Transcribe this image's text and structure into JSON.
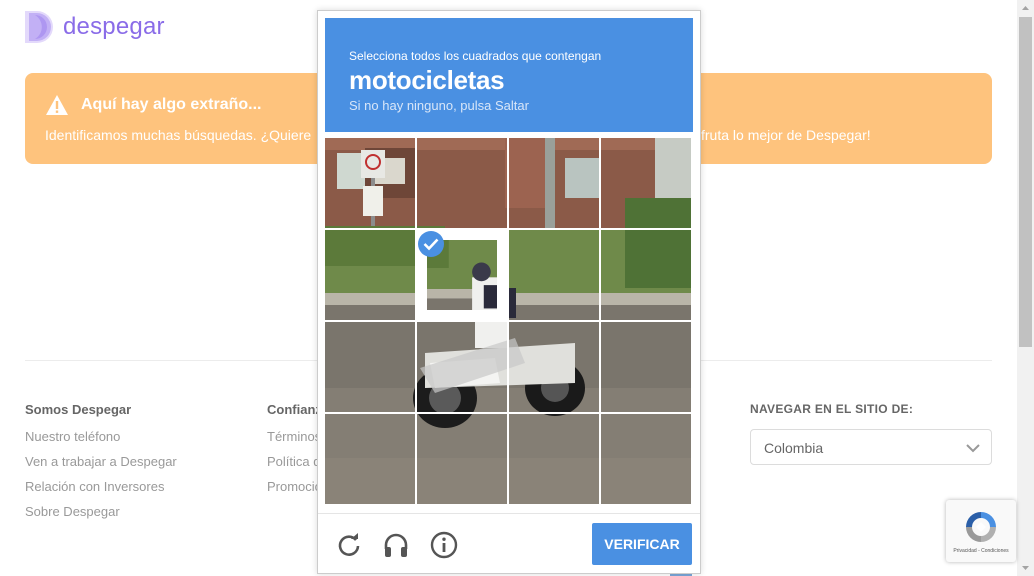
{
  "site": {
    "logo_text": "despegar",
    "brand_color": "#8a6ce8"
  },
  "banner": {
    "title": "Aquí hay algo extraño...",
    "text_left": "Identificamos muchas búsquedas. ¿Quiere",
    "text_right": "fruta lo mejor de Despegar!",
    "color": "#fec37d",
    "icon": "warning-icon"
  },
  "footer": {
    "col1": {
      "heading": "Somos Despegar",
      "links": [
        "Nuestro teléfono",
        "Ven a trabajar a Despegar",
        "Relación con Inversores",
        "Sobre Despegar"
      ]
    },
    "col2": {
      "heading": "Confianza",
      "links": [
        "Términos",
        "Política de",
        "Promociones"
      ]
    },
    "nav_site": {
      "heading": "NAVEGAR EN EL SITIO DE:",
      "selected": "Colombia"
    }
  },
  "challenge": {
    "instruction": "Selecciona todos los cuadrados que contengan",
    "keyword": "motocicletas",
    "hint": "Si no hay ninguno, pulsa Saltar",
    "header_color": "#4a90e2",
    "grid_size": 4,
    "selected_tiles": [
      5
    ],
    "buttons": {
      "reload_icon": "reload-icon",
      "audio_icon": "headphones-icon",
      "info_icon": "info-icon",
      "verify_label": "VERIFICAR"
    }
  },
  "recaptcha_badge": {
    "privacy_text": "Privacidad - Condiciones"
  }
}
